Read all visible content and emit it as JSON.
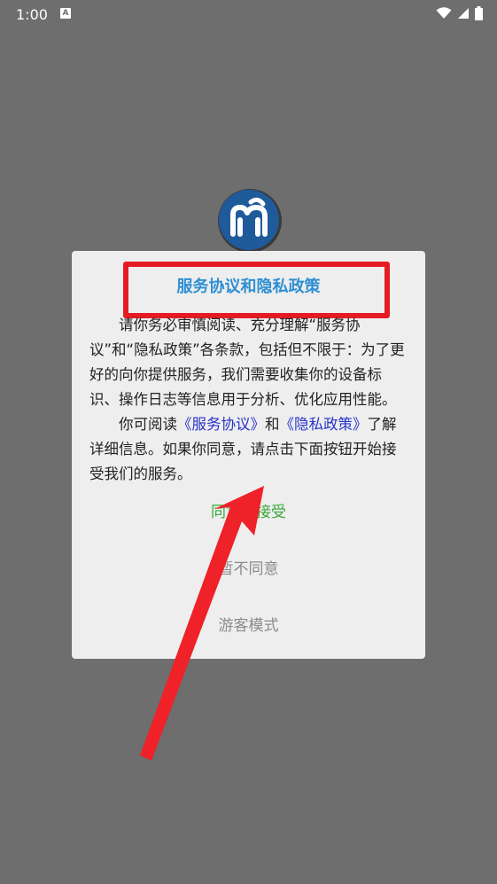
{
  "status_bar": {
    "time": "1:00",
    "notification_icon": "A",
    "icons": [
      "wifi-icon",
      "signal-icon",
      "battery-icon"
    ]
  },
  "dialog": {
    "title": "服务协议和隐私政策",
    "paragraph1": "请你务必审慎阅读、充分理解“服务协议”和“隐私政策”各条款，包括但不限于：为了更好的向你提供服务，我们需要收集你的设备标识、操作日志等信息用于分析、优化应用性能。",
    "paragraph2_prefix": "你可阅读",
    "service_link": "《服务协议》",
    "and_text": "和",
    "privacy_link": "《隐私政策》",
    "paragraph2_suffix": "了解详细信息。如果你同意，请点击下面按钮开始接受我们的服务。",
    "accept_label": "同意并接受",
    "decline_label": "暂不同意",
    "guest_label": "游客模式"
  },
  "colors": {
    "backdrop": "#6e6e6e",
    "title": "#2f8fd3",
    "link": "#2833c9",
    "accept": "#35a935",
    "secondary": "#8a8a8a",
    "annotation_red": "#e51b24"
  }
}
